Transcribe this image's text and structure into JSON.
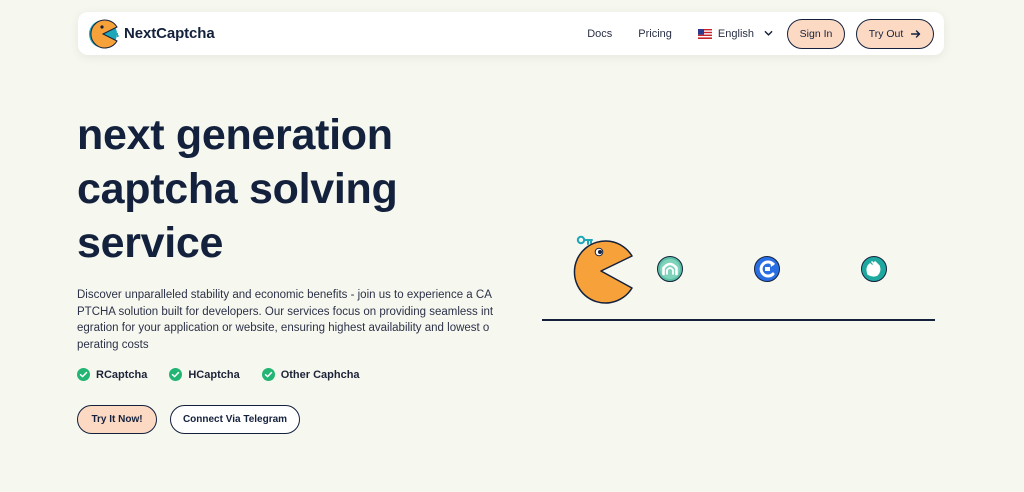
{
  "nav": {
    "brand": "NextCaptcha",
    "links": [
      "Docs",
      "Pricing"
    ],
    "language": "English",
    "sign_in": "Sign In",
    "try_out": "Try Out"
  },
  "hero": {
    "title": "next generation\ncaptcha solving\nservice",
    "description": "Discover unparalleled stability and economic benefits - join us to experience a CAPTCHA solution built for developers. Our services focus on providing seamless integration for your application or website, ensuring highest availability and lowest operating costs",
    "features": [
      "RCaptcha",
      "HCaptcha",
      "Other Caphcha"
    ],
    "cta_primary": "Try It Now!",
    "cta_secondary": "Connect Via Telegram"
  },
  "colors": {
    "background": "#f6f8f0",
    "accent": "#fcd9c3",
    "text": "#14213d",
    "check": "#22b573",
    "pacman": "#f7a13b"
  },
  "icons": {
    "logo": "pacman-key-logo",
    "language_flag": "us-flag-icon",
    "language_chevron": "chevron-down-icon",
    "try_out_arrow": "arrow-right-icon",
    "feature_check": "check-circle-icon",
    "illustration": [
      "pacman-icon",
      "captcha-shield-icon",
      "recaptcha-icon",
      "hcaptcha-hand-icon"
    ]
  }
}
